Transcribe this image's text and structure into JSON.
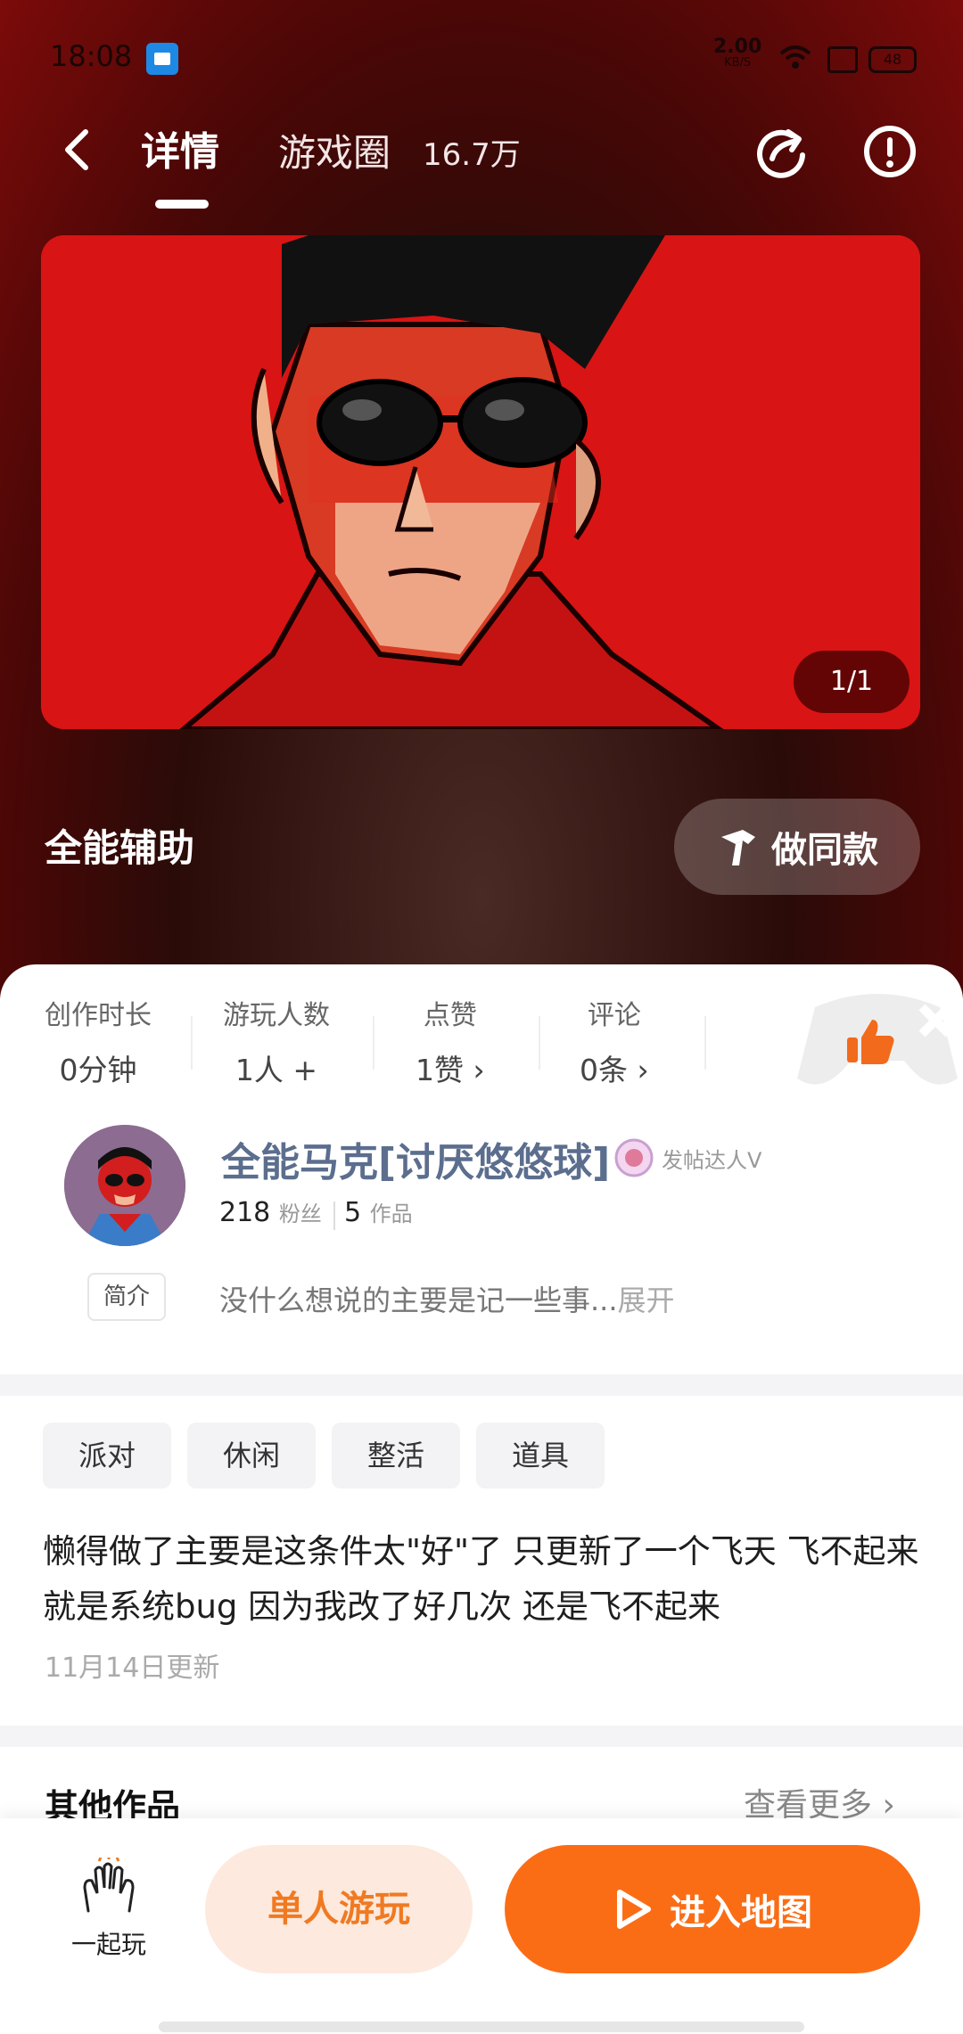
{
  "status": {
    "time": "18:08",
    "speed_value": "2.00",
    "speed_unit": "KB/S",
    "battery": "48"
  },
  "nav": {
    "tab_detail": "详情",
    "tab_circle": "游戏圈",
    "circle_count": "16.7万"
  },
  "banner": {
    "counter": "1/1"
  },
  "map": {
    "title": "全能辅助",
    "make_same": "做同款"
  },
  "stats": [
    {
      "label": "创作时长",
      "value": "0分钟"
    },
    {
      "label": "游玩人数",
      "value": "1人 +"
    },
    {
      "label": "点赞",
      "value": "1赞 ›"
    },
    {
      "label": "评论",
      "value": "0条 ›"
    }
  ],
  "author": {
    "name": "全能马克[讨厌悠悠球]",
    "badge": "发帖达人Ⅴ",
    "fans_count": "218",
    "fans_label": "粉丝",
    "works_count": "5",
    "works_label": "作品",
    "intro_tag": "简介",
    "intro_text": "没什么想说的主要是记一些事...",
    "expand": "展开"
  },
  "tags": [
    "派对",
    "休闲",
    "整活",
    "道具"
  ],
  "description": "懒得做了主要是这条件太\"好\"了 只更新了一个飞天 飞不起来就是系统bug 因为我改了好几次 还是飞不起来",
  "update_date": "11月14日更新",
  "other": {
    "title": "其他作品",
    "see_more": "查看更多 ›"
  },
  "bottom": {
    "together": "一起玩",
    "solo": "单人游玩",
    "enter": "进入地图"
  },
  "colors": {
    "accent": "#fb6d15",
    "solo_bg": "#fde9dd",
    "hero_red": "#d91414",
    "author_name": "#5c6e8e"
  }
}
